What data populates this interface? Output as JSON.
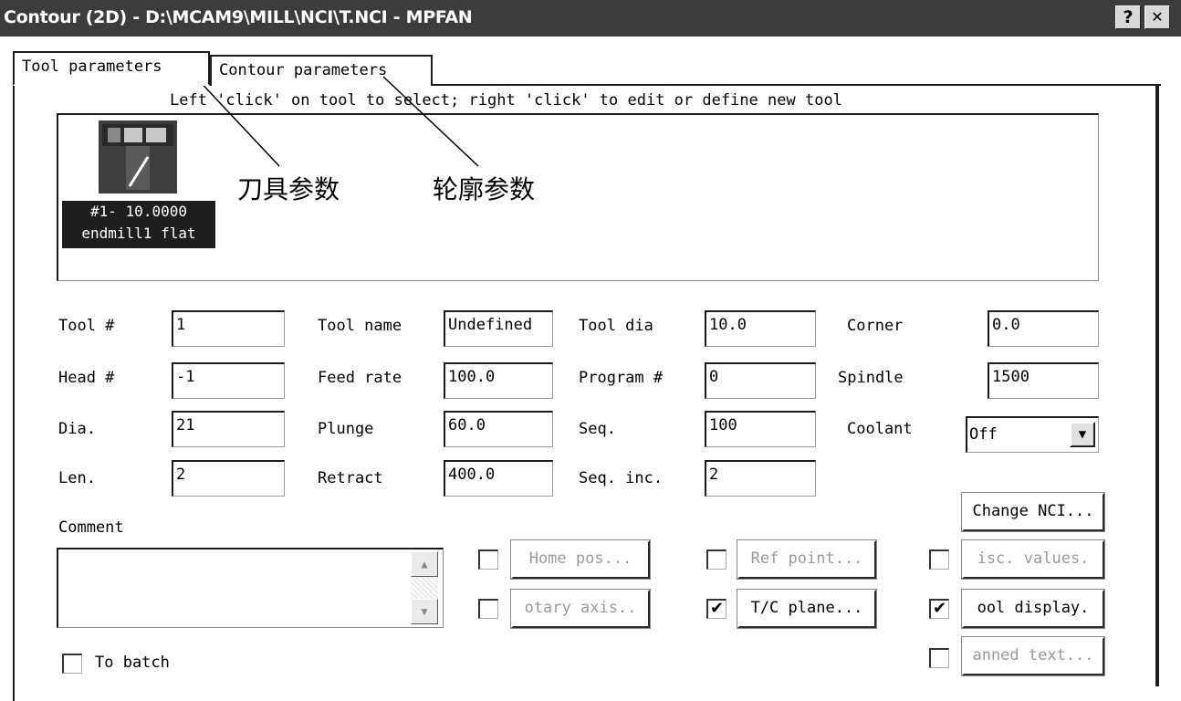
{
  "window": {
    "title": "Contour (2D) - D:\\MCAM9\\MILL\\NCI\\T.NCI - MPFAN",
    "help_label": "?",
    "close_label": "✕"
  },
  "tabs": [
    {
      "label": "Tool parameters"
    },
    {
      "label": "Contour parameters"
    }
  ],
  "tool_list": {
    "hint": "Left 'click' on tool to select; right 'click' to edit or define new tool",
    "tool": {
      "number_line": "#1- 10.0000",
      "name_line": "endmill1 flat"
    }
  },
  "annotations": {
    "tool_params_cn": "刀具参数",
    "contour_params_cn": "轮廓参数"
  },
  "fields": {
    "tool_num": {
      "label": "Tool #",
      "value": "1"
    },
    "head_num": {
      "label": "Head #",
      "value": "-1"
    },
    "dia": {
      "label": "Dia.",
      "value": "21"
    },
    "len": {
      "label": "Len.",
      "value": "2"
    },
    "tool_name": {
      "label": "Tool name",
      "value": "Undefined"
    },
    "feed_rate": {
      "label": "Feed rate",
      "value": "100.0"
    },
    "plunge": {
      "label": "Plunge",
      "value": "60.0"
    },
    "retract": {
      "label": "Retract",
      "value": "400.0"
    },
    "tool_dia": {
      "label": "Tool dia",
      "value": "10.0"
    },
    "program_num": {
      "label": "Program #",
      "value": "0"
    },
    "seq": {
      "label": "Seq.",
      "value": "100"
    },
    "seq_inc": {
      "label": "Seq. inc.",
      "value": "2"
    },
    "corner": {
      "label": "Corner",
      "value": "0.0"
    },
    "spindle": {
      "label": "Spindle",
      "value": "1500"
    },
    "coolant": {
      "label": "Coolant",
      "value": "Off"
    }
  },
  "comment": {
    "label": "Comment",
    "value": ""
  },
  "buttons": {
    "change_nci": "Change NCI...",
    "home_pos": "Home pos...",
    "ref_point": "Ref point...",
    "misc_values": "isc. values.",
    "rotary_axis": "otary axis..",
    "tc_plane": "T/C plane...",
    "tool_display": "ool display.",
    "canned_text": "anned text..."
  },
  "checkboxes": {
    "home_pos": false,
    "ref_point": false,
    "misc_values": false,
    "rotary_axis": false,
    "tc_plane": true,
    "tool_display": true,
    "canned_text": false,
    "to_batch": {
      "label": "To batch",
      "checked": false
    }
  },
  "glyphs": {
    "check": "✔",
    "down_arrow": "▼",
    "up_arrow": "▲"
  }
}
